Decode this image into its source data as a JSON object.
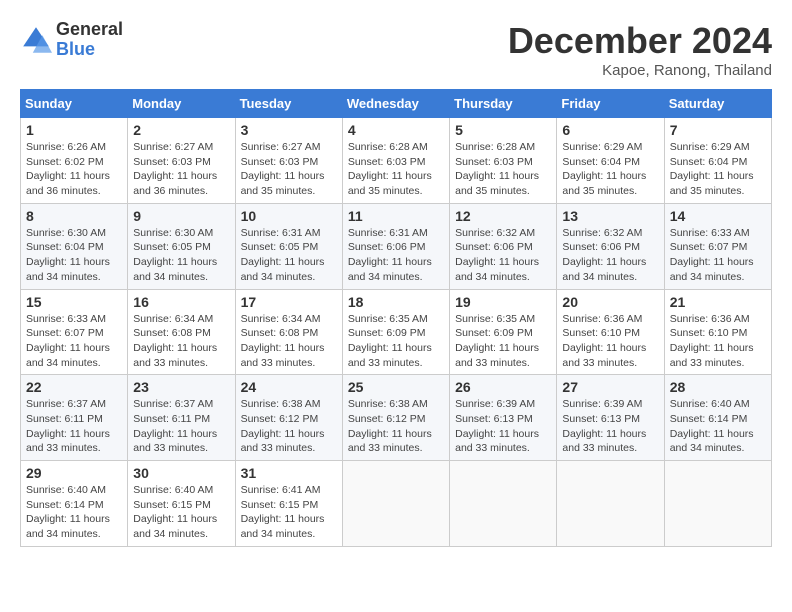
{
  "logo": {
    "general": "General",
    "blue": "Blue"
  },
  "header": {
    "month": "December 2024",
    "location": "Kapoe, Ranong, Thailand"
  },
  "weekdays": [
    "Sunday",
    "Monday",
    "Tuesday",
    "Wednesday",
    "Thursday",
    "Friday",
    "Saturday"
  ],
  "weeks": [
    [
      {
        "day": "1",
        "sunrise": "6:26 AM",
        "sunset": "6:02 PM",
        "daylight": "11 hours and 36 minutes."
      },
      {
        "day": "2",
        "sunrise": "6:27 AM",
        "sunset": "6:03 PM",
        "daylight": "11 hours and 36 minutes."
      },
      {
        "day": "3",
        "sunrise": "6:27 AM",
        "sunset": "6:03 PM",
        "daylight": "11 hours and 35 minutes."
      },
      {
        "day": "4",
        "sunrise": "6:28 AM",
        "sunset": "6:03 PM",
        "daylight": "11 hours and 35 minutes."
      },
      {
        "day": "5",
        "sunrise": "6:28 AM",
        "sunset": "6:03 PM",
        "daylight": "11 hours and 35 minutes."
      },
      {
        "day": "6",
        "sunrise": "6:29 AM",
        "sunset": "6:04 PM",
        "daylight": "11 hours and 35 minutes."
      },
      {
        "day": "7",
        "sunrise": "6:29 AM",
        "sunset": "6:04 PM",
        "daylight": "11 hours and 35 minutes."
      }
    ],
    [
      {
        "day": "8",
        "sunrise": "6:30 AM",
        "sunset": "6:04 PM",
        "daylight": "11 hours and 34 minutes."
      },
      {
        "day": "9",
        "sunrise": "6:30 AM",
        "sunset": "6:05 PM",
        "daylight": "11 hours and 34 minutes."
      },
      {
        "day": "10",
        "sunrise": "6:31 AM",
        "sunset": "6:05 PM",
        "daylight": "11 hours and 34 minutes."
      },
      {
        "day": "11",
        "sunrise": "6:31 AM",
        "sunset": "6:06 PM",
        "daylight": "11 hours and 34 minutes."
      },
      {
        "day": "12",
        "sunrise": "6:32 AM",
        "sunset": "6:06 PM",
        "daylight": "11 hours and 34 minutes."
      },
      {
        "day": "13",
        "sunrise": "6:32 AM",
        "sunset": "6:06 PM",
        "daylight": "11 hours and 34 minutes."
      },
      {
        "day": "14",
        "sunrise": "6:33 AM",
        "sunset": "6:07 PM",
        "daylight": "11 hours and 34 minutes."
      }
    ],
    [
      {
        "day": "15",
        "sunrise": "6:33 AM",
        "sunset": "6:07 PM",
        "daylight": "11 hours and 34 minutes."
      },
      {
        "day": "16",
        "sunrise": "6:34 AM",
        "sunset": "6:08 PM",
        "daylight": "11 hours and 33 minutes."
      },
      {
        "day": "17",
        "sunrise": "6:34 AM",
        "sunset": "6:08 PM",
        "daylight": "11 hours and 33 minutes."
      },
      {
        "day": "18",
        "sunrise": "6:35 AM",
        "sunset": "6:09 PM",
        "daylight": "11 hours and 33 minutes."
      },
      {
        "day": "19",
        "sunrise": "6:35 AM",
        "sunset": "6:09 PM",
        "daylight": "11 hours and 33 minutes."
      },
      {
        "day": "20",
        "sunrise": "6:36 AM",
        "sunset": "6:10 PM",
        "daylight": "11 hours and 33 minutes."
      },
      {
        "day": "21",
        "sunrise": "6:36 AM",
        "sunset": "6:10 PM",
        "daylight": "11 hours and 33 minutes."
      }
    ],
    [
      {
        "day": "22",
        "sunrise": "6:37 AM",
        "sunset": "6:11 PM",
        "daylight": "11 hours and 33 minutes."
      },
      {
        "day": "23",
        "sunrise": "6:37 AM",
        "sunset": "6:11 PM",
        "daylight": "11 hours and 33 minutes."
      },
      {
        "day": "24",
        "sunrise": "6:38 AM",
        "sunset": "6:12 PM",
        "daylight": "11 hours and 33 minutes."
      },
      {
        "day": "25",
        "sunrise": "6:38 AM",
        "sunset": "6:12 PM",
        "daylight": "11 hours and 33 minutes."
      },
      {
        "day": "26",
        "sunrise": "6:39 AM",
        "sunset": "6:13 PM",
        "daylight": "11 hours and 33 minutes."
      },
      {
        "day": "27",
        "sunrise": "6:39 AM",
        "sunset": "6:13 PM",
        "daylight": "11 hours and 33 minutes."
      },
      {
        "day": "28",
        "sunrise": "6:40 AM",
        "sunset": "6:14 PM",
        "daylight": "11 hours and 34 minutes."
      }
    ],
    [
      {
        "day": "29",
        "sunrise": "6:40 AM",
        "sunset": "6:14 PM",
        "daylight": "11 hours and 34 minutes."
      },
      {
        "day": "30",
        "sunrise": "6:40 AM",
        "sunset": "6:15 PM",
        "daylight": "11 hours and 34 minutes."
      },
      {
        "day": "31",
        "sunrise": "6:41 AM",
        "sunset": "6:15 PM",
        "daylight": "11 hours and 34 minutes."
      },
      null,
      null,
      null,
      null
    ]
  ],
  "labels": {
    "sunrise": "Sunrise:",
    "sunset": "Sunset:",
    "daylight": "Daylight:"
  }
}
